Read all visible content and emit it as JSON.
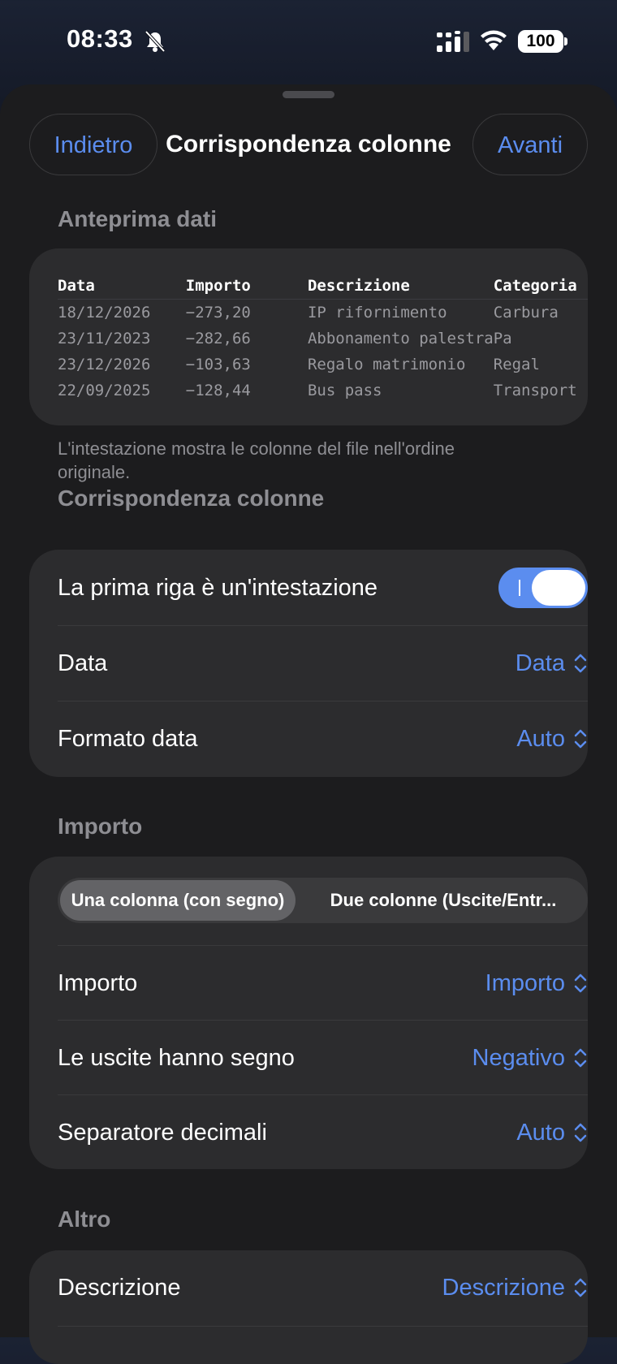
{
  "status_bar": {
    "time": "08:33",
    "battery": "100"
  },
  "nav": {
    "back_label": "Indietro",
    "title": "Corrispondenza colonne",
    "next_label": "Avanti"
  },
  "preview": {
    "section_title": "Anteprima dati",
    "headers": [
      "Data",
      "Importo",
      "Descrizione",
      "Categoria"
    ],
    "rows": [
      [
        "18/12/2026",
        "−273,20",
        "IP rifornimento",
        "Carbura"
      ],
      [
        "23/11/2023",
        "−282,66",
        "Abbonamento palestra",
        "Pa"
      ],
      [
        "23/12/2026",
        "−103,63",
        "Regalo matrimonio",
        "Regal"
      ],
      [
        "22/09/2025",
        "−128,44",
        "Bus pass",
        "Transport"
      ]
    ],
    "footnote": "L'intestazione mostra le colonne del file nell'ordine originale."
  },
  "mapping": {
    "section_title": "Corrispondenza colonne",
    "header_toggle_label": "La prima riga è un'intestazione",
    "header_toggle_on": true,
    "date_label": "Data",
    "date_value": "Data",
    "date_format_label": "Formato data",
    "date_format_value": "Auto"
  },
  "amount": {
    "section_title": "Importo",
    "mode_options": [
      "Una colonna (con segno)",
      "Due colonne (Uscite/Entr..."
    ],
    "mode_selected": "Una colonna (con segno)",
    "amount_label": "Importo",
    "amount_value": "Importo",
    "sign_label": "Le uscite hanno segno",
    "sign_value": "Negativo",
    "decimal_label": "Separatore decimali",
    "decimal_value": "Auto"
  },
  "other": {
    "section_title": "Altro",
    "description_label": "Descrizione",
    "description_value": "Descrizione"
  },
  "colors": {
    "accent": "#5b8def",
    "sheet": "#1c1c1e",
    "card": "#2c2c2e",
    "secondary_text": "#8e8e93"
  }
}
